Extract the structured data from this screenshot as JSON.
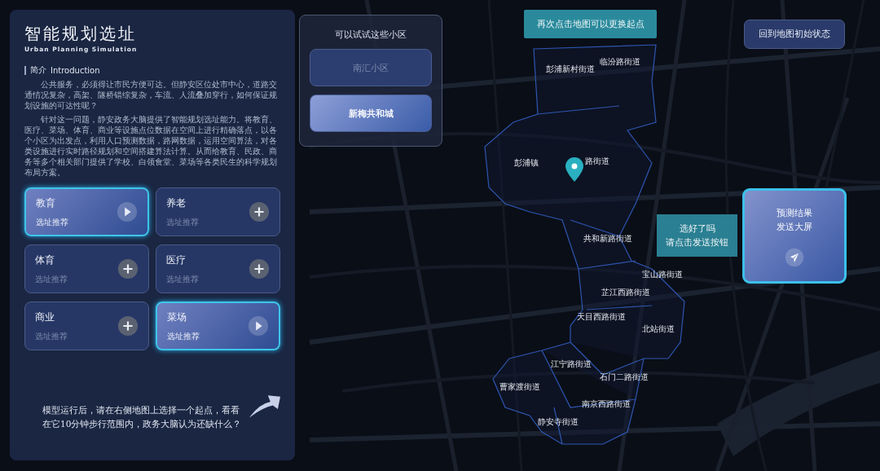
{
  "header": {
    "title": "智能规划选址",
    "subtitle": "Urban Planning Simulation"
  },
  "intro": {
    "heading": "简介",
    "heading_en": "Introduction",
    "paragraphs": [
      "公共服务，必须得让市民方便可达。但静安区位处市中心，道路交通情况复杂，高架、隧桥错综复杂，车流、人流叠加穿行，如何保证规划设施的可达性呢？",
      "针对这一问题，静安政务大脑提供了智能规划选址能力。将教育、医疗、菜场、体育、商业等设施点位数据在空间上进行精确落点，以各个小区为出发点，利用人口预测数据，路网数据，运用空间算法，对各类设施进行实时路径规划和空间搭建算法计算。从而给教育、民政、商务等多个相关部门提供了学校、白领食堂、菜场等各类民生的科学规划布局方案。"
    ]
  },
  "categories": [
    {
      "name": "教育",
      "action": "选址推荐",
      "selected": true
    },
    {
      "name": "养老",
      "action": "选址推荐",
      "selected": false
    },
    {
      "name": "体育",
      "action": "选址推荐",
      "selected": false
    },
    {
      "name": "医疗",
      "action": "选址推荐",
      "selected": false
    },
    {
      "name": "商业",
      "action": "选址推荐",
      "selected": false
    },
    {
      "name": "菜场",
      "action": "选址推荐",
      "selected": true
    }
  ],
  "hint": "模型运行后，请在右侧地图上选择一个起点，看看在它10分钟步行范围内，政务大脑认为还缺什么？",
  "communities": {
    "title": "可以试试这些小区",
    "items": [
      {
        "name": "南汇小区",
        "selected": false
      },
      {
        "name": "新梅共和城",
        "selected": true
      }
    ]
  },
  "map": {
    "tip": "再次点击地图可以更换起点",
    "reset_button": "回到地图初始状态",
    "labels": [
      "彭浦新村街道",
      "临汾路街道",
      "彭浦镇",
      "路街道",
      "共和新路街道",
      "宝山路街道",
      "芷江西路街道",
      "天目西路街道",
      "北站街道",
      "江宁路街道",
      "石门二路街道",
      "曹家渡街道",
      "南京西路街道",
      "静安寺街道"
    ],
    "prompt": [
      "选好了吗",
      "请点击发送按钮"
    ],
    "send_card": [
      "预测结果",
      "发送大屏"
    ]
  }
}
